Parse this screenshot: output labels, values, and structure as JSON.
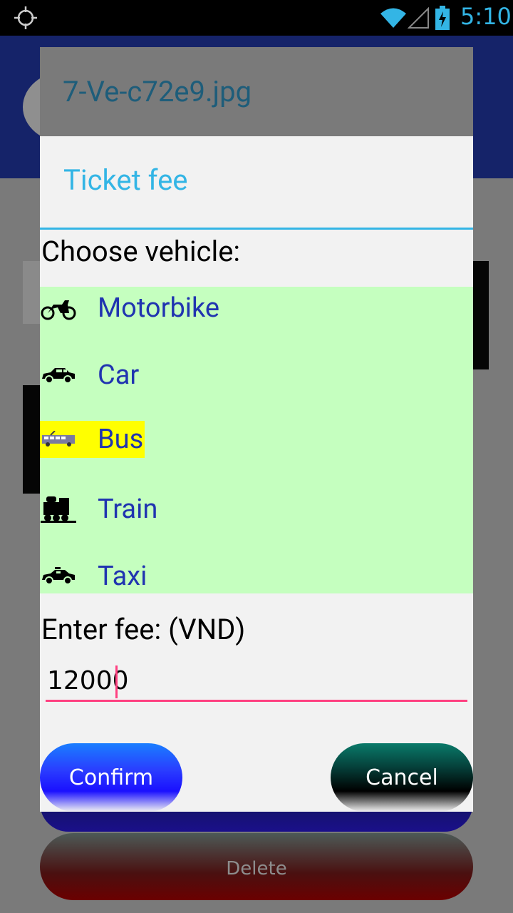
{
  "status_bar": {
    "time": "5:10",
    "icons": [
      "gps-icon",
      "wifi-icon",
      "signal-icon",
      "battery-charging-icon"
    ]
  },
  "background": {
    "dialog_title": "7-Ve-c72e9.jpg",
    "delete_label": "Delete"
  },
  "dialog": {
    "title": "Ticket fee",
    "choose_label": "Choose vehicle:",
    "vehicles": [
      {
        "label": "Motorbike",
        "icon": "motorbike-icon"
      },
      {
        "label": "Car",
        "icon": "car-icon"
      },
      {
        "label": "Bus",
        "icon": "bus-icon",
        "selected": true
      },
      {
        "label": "Train",
        "icon": "train-icon"
      },
      {
        "label": "Taxi",
        "icon": "taxi-icon"
      }
    ],
    "fee_label": "Enter fee: (VND)",
    "fee_value": "12000",
    "confirm_label": "Confirm",
    "cancel_label": "Cancel"
  },
  "colors": {
    "accent": "#33b5e5",
    "list_bg": "#c5ffbf",
    "selected_bg": "#ffff00",
    "vehicle_text": "#2034b0",
    "input_underline": "#ff4081"
  }
}
